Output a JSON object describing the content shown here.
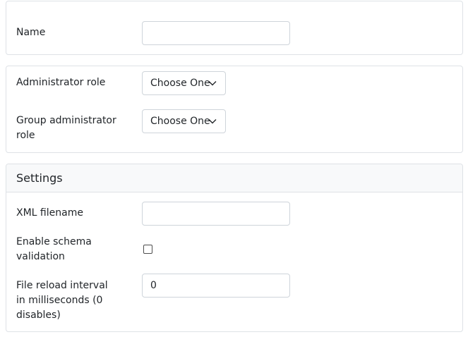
{
  "name_section": {
    "name_label": "Name",
    "name_value": ""
  },
  "roles_section": {
    "admin_role_label": "Administrator role",
    "admin_role_value": "Choose One",
    "group_admin_role_label": "Group administrator role",
    "group_admin_role_value": "Choose One",
    "chevron_icon": "chevron-down-icon"
  },
  "settings_section": {
    "title": "Settings",
    "xml_filename_label": "XML filename",
    "xml_filename_value": "",
    "schema_validation_label": "Enable schema validation",
    "schema_validation_checked": false,
    "reload_interval_label": "File reload interval in milliseconds (0 disables)",
    "reload_interval_value": "0"
  },
  "colors": {
    "border": "#dee2e6",
    "input_border": "#ced4da",
    "header_bg": "#f8f9fa",
    "text": "#212529"
  }
}
